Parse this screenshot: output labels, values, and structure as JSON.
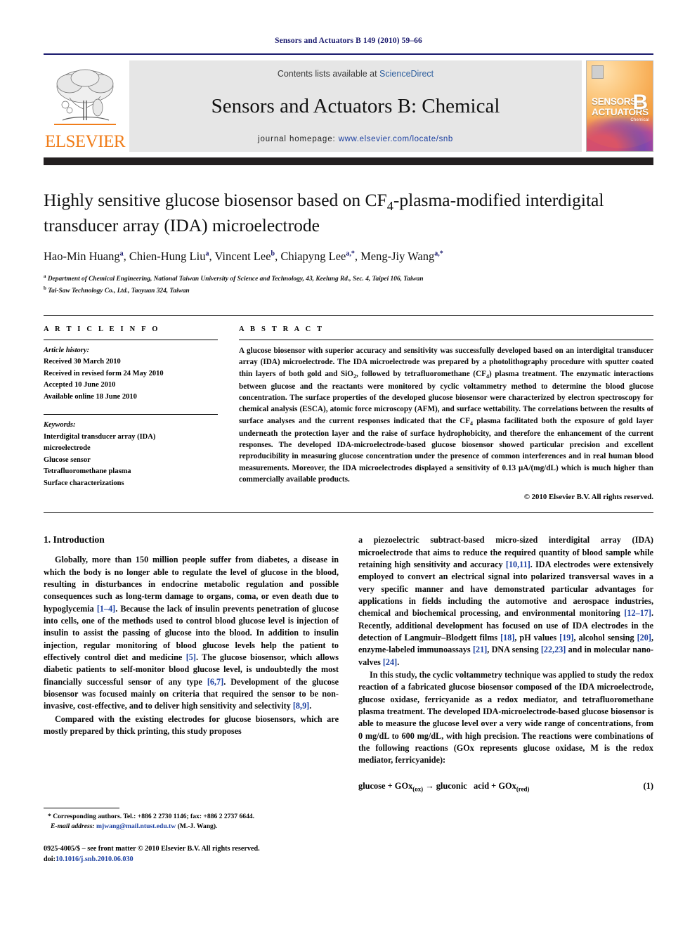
{
  "running_head": "Sensors and Actuators B 149 (2010) 59–66",
  "header": {
    "contents_prefix": "Contents lists available at ",
    "contents_link": "ScienceDirect",
    "journal_title": "Sensors and Actuators B: Chemical",
    "homepage_label": "journal homepage:",
    "homepage_url": "www.elsevier.com/locate/snb",
    "publisher_logo_text": "ELSEVIER",
    "cover": {
      "line1": "SENSORS",
      "line1_small": "and",
      "line2": "ACTUATORS",
      "letter": "B",
      "subtitle": "Chemical"
    },
    "rule_color": "#1a1a6e",
    "band_color": "#e6e6e6",
    "bar_color": "#231f20"
  },
  "article": {
    "title": "Highly sensitive glucose biosensor based on CF₄-plasma-modified interdigital transducer array (IDA) microelectrode",
    "title_part1": "Highly sensitive glucose biosensor based on CF",
    "title_sub": "4",
    "title_part2": "-plasma-modified interdigital transducer array (IDA) microelectrode",
    "authors": [
      {
        "name": "Hao-Min Huang",
        "sup": "a"
      },
      {
        "name": "Chien-Hung Liu",
        "sup": "a"
      },
      {
        "name": "Vincent Lee",
        "sup": "b"
      },
      {
        "name": "Chiapyng Lee",
        "sup": "a,*"
      },
      {
        "name": "Meng-Jiy Wang",
        "sup": "a,*"
      }
    ],
    "affiliations": [
      {
        "mark": "a",
        "text": "Department of Chemical Engineering, National Taiwan University of Science and Technology, 43, Keelung Rd., Sec. 4, Taipei 106, Taiwan"
      },
      {
        "mark": "b",
        "text": "Tai-Saw Technology Co., Ltd., Taoyuan 324, Taiwan"
      }
    ]
  },
  "article_info": {
    "heading": "A R T I C L E   I N F O",
    "history_label": "Article history:",
    "history": [
      "Received 30 March 2010",
      "Received in revised form 24 May 2010",
      "Accepted 10 June 2010",
      "Available online 18 June 2010"
    ],
    "keywords_label": "Keywords:",
    "keywords": [
      "Interdigital transducer array (IDA)",
      "microelectrode",
      "Glucose sensor",
      "Tetrafluoromethane plasma",
      "Surface characterizations"
    ]
  },
  "abstract": {
    "heading": "A B S T R A C T",
    "p1": "A glucose biosensor with superior accuracy and sensitivity was successfully developed based on an interdigital transducer array (IDA) microelectrode. The IDA microelectrode was prepared by a photolithography procedure with sputter coated thin layers of both gold and SiO",
    "p1_sub1": "2",
    "p2": ", followed by tetrafluoromethane (CF",
    "p2_sub": "4",
    "p3": ") plasma treatment. The enzymatic interactions between glucose and the reactants were monitored by cyclic voltammetry method to determine the blood glucose concentration. The surface properties of the developed glucose biosensor were characterized by electron spectroscopy for chemical analysis (ESCA), atomic force microscopy (AFM), and surface wettability. The correlations between the results of surface analyses and the current responses indicated that the CF",
    "p3_sub": "4",
    "p4": " plasma facilitated both the exposure of gold layer underneath the protection layer and the raise of surface hydrophobicity, and therefore the enhancement of the current responses. The developed IDA-microelectrode-based glucose biosensor showed particular precision and excellent reproducibility in measuring glucose concentration under the presence of common interferences and in real human blood measurements. Moreover, the IDA microelectrodes displayed a sensitivity of 0.13 μA/(mg/dL) which is much higher than commercially available products.",
    "copyright": "© 2010 Elsevier B.V. All rights reserved."
  },
  "body": {
    "section_number_title": "1.  Introduction",
    "left_p1_a": "Globally, more than 150 million people suffer from diabetes, a disease in which the body is no longer able to regulate the level of glucose in the blood, resulting in disturbances in endocrine metabolic regulation and possible consequences such as long-term damage to organs, coma, or even death due to hypoglycemia ",
    "left_p1_ref1": "[1–4]",
    "left_p1_b": ". Because the lack of insulin prevents penetration of glucose into cells, one of the methods used to control blood glucose level is injection of insulin to assist the passing of glucose into the blood. In addition to insulin injection, regular monitoring of blood glucose levels help the patient to effectively control diet and medicine ",
    "left_p1_ref2": "[5]",
    "left_p1_c": ". The glucose biosensor, which allows diabetic patients to self-monitor blood glucose level, is undoubtedly the most financially successful sensor of any type ",
    "left_p1_ref3": "[6,7]",
    "left_p1_d": ". Development of the glucose biosensor was focused mainly on criteria that required the sensor to be non-invasive, cost-effective, and to deliver high sensitivity and selectivity ",
    "left_p1_ref4": "[8,9]",
    "left_p1_e": ".",
    "left_p2": "Compared with the existing electrodes for glucose biosensors, which are mostly prepared by thick printing, this study proposes",
    "right_p1_a": "a piezoelectric subtract-based micro-sized interdigital array (IDA) microelectrode that aims to reduce the required quantity of blood sample while retaining high sensitivity and accuracy ",
    "right_p1_ref1": "[10,11]",
    "right_p1_b": ". IDA electrodes were extensively employed to convert an electrical signal into polarized transversal waves in a very specific manner and have demonstrated particular advantages for applications in fields including the automotive and aerospace industries, chemical and biochemical processing, and environmental monitoring ",
    "right_p1_ref2": "[12–17]",
    "right_p1_c": ". Recently, additional development has focused on use of IDA electrodes in the detection of Langmuir–Blodgett films ",
    "right_p1_ref3": "[18]",
    "right_p1_d": ", pH values ",
    "right_p1_ref4": "[19]",
    "right_p1_e": ", alcohol sensing ",
    "right_p1_ref5": "[20]",
    "right_p1_f": ", enzyme-labeled immunoassays ",
    "right_p1_ref6": "[21]",
    "right_p1_g": ", DNA sensing ",
    "right_p1_ref7": "[22,23]",
    "right_p1_h": " and in molecular nano-valves ",
    "right_p1_ref8": "[24]",
    "right_p1_i": ".",
    "right_p2": "In this study, the cyclic voltammetry technique was applied to study the redox reaction of a fabricated glucose biosensor composed of the IDA microelectrode, glucose oxidase, ferricyanide as a redox mediator, and tetrafluoromethane plasma treatment. The developed IDA-microelectrode-based glucose biosensor is able to measure the glucose level over a very wide range of concentrations, from 0 mg/dL to 600 mg/dL, with high precision. The reactions were combinations of the following reactions (GOx represents glucose oxidase, M is the redox mediator, ferricyanide):",
    "equation_1": "glucose + GOx(ox) → gluconic   acid + GOx(red)",
    "equation_1_number": "(1)"
  },
  "footer": {
    "corresponding_mark": "*",
    "corresponding_text": " Corresponding authors. Tel.: +886 2 2730 1146; fax: +886 2 2737 6644.",
    "email_label": "E-mail address:",
    "email": "mjwang@mail.ntust.edu.tw",
    "email_suffix": " (M.-J. Wang).",
    "imprint_line1": "0925-4005/$ – see front matter © 2010 Elsevier B.V. All rights reserved.",
    "imprint_doi_label": "doi:",
    "imprint_doi": "10.1016/j.snb.2010.06.030"
  }
}
